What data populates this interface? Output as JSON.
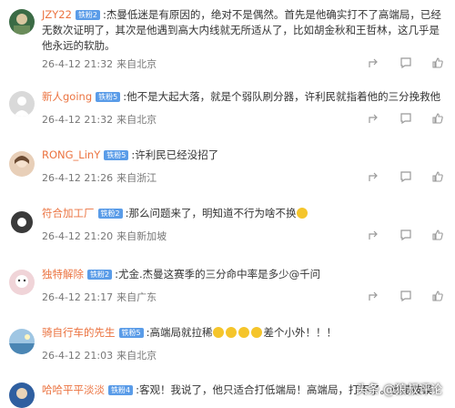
{
  "comments": [
    {
      "user": "JZY22",
      "badge": "铁粉2",
      "text": ":杰曼低迷是有原因的，绝对不是偶然。首先是他确实打不了高端局，已经无数次证明了，其次是他遇到高大内线就无所适从了，比如胡金秋和王哲林，这几乎是他永远的软肋。",
      "time": "26-4-12 21:32",
      "location": "来自北京",
      "avatar_color": "#3b6b45"
    },
    {
      "user": "新人going",
      "badge": "铁粉5",
      "text": ":他不是大起大落，就是个弱队刷分器，许利民就指着他的三分挽救他",
      "time": "26-4-12 21:32",
      "location": "来自北京",
      "avatar_color": "#d9d9d9"
    },
    {
      "user": "RONG_LinY",
      "badge": "铁粉5",
      "text": ":许利民已经没招了",
      "time": "26-4-12 21:26",
      "location": "来自浙江",
      "avatar_color": "#e8cfb8"
    },
    {
      "user": "符合加工厂",
      "badge": "铁粉2",
      "text": ":那么问题来了，明知道不行为啥不换",
      "time": "26-4-12 21:20",
      "location": "来自新加坡",
      "avatar_color": "#3a3a3a"
    },
    {
      "user": "独特解除",
      "badge": "铁粉2",
      "text": ":尤金.杰曼这赛季的三分命中率是多少@千问",
      "time": "26-4-12 21:17",
      "location": "来自广东",
      "avatar_color": "#f0d4d8"
    },
    {
      "user": "骑自行车的先生",
      "badge": "铁粉5",
      "text": ":高端局就拉稀",
      "text2": "差个小外！！！",
      "time": "26-4-12 21:03",
      "location": "来自北京",
      "avatar_color": "#4b86b4"
    },
    {
      "user": "哈哈平平淡淡",
      "badge": "铁粉4",
      "text": ":客观！我说了，他只适合打低端局！高端局，打不了。也是被误",
      "time": "",
      "location": "",
      "avatar_color": "#2f5fa0"
    }
  ],
  "watermark": "头条 @狼叔评论",
  "icons": [
    "share-icon",
    "comment-icon",
    "like-icon"
  ]
}
